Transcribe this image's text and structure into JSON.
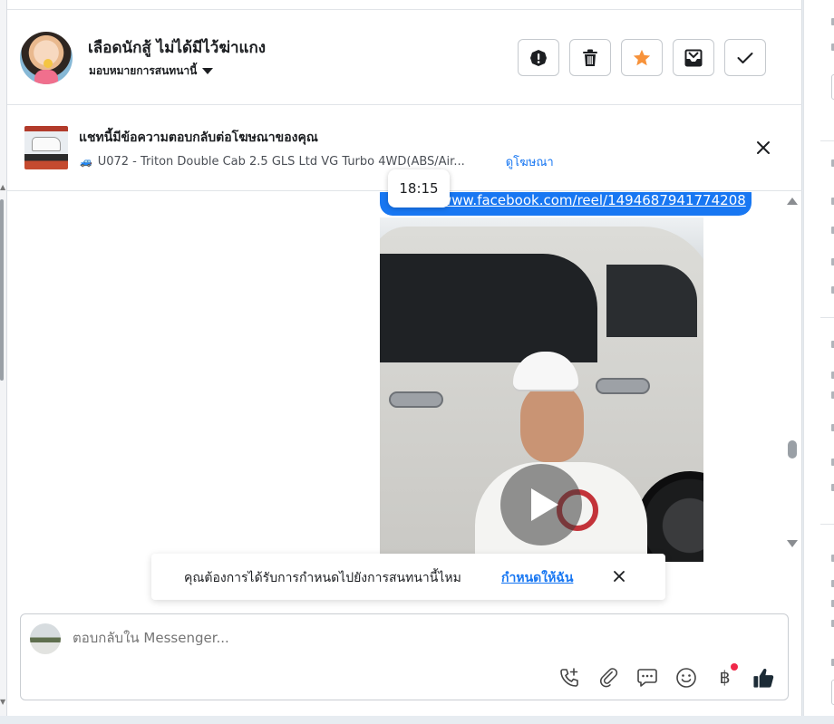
{
  "header": {
    "contact_name": "เลือดนักสู้ ไม่ได้มีไว้ฆ่าแกง",
    "assign_label": "มอบหมายการสนทนานี้",
    "actions": {
      "spam": "exclamation-icon",
      "delete": "trash-icon",
      "star": "star-icon",
      "move": "inbox-icon",
      "done": "check-icon"
    },
    "star_color": "#f7923a"
  },
  "ad_banner": {
    "title": "แชทนี้มีข้อความตอบกลับต่อโฆษณาของคุณ",
    "subtitle": "U072 - Triton Double Cab 2.5 GLS Ltd VG Turbo 4WD(ABS/Air...",
    "view_ad_link": "ดูโฆษณา"
  },
  "conversation": {
    "link_text": "www.facebook.com/reel/1494687941774208",
    "timestamp_tooltip": "18:15",
    "accent_color": "#1877f2"
  },
  "assign_prompt": {
    "question": "คุณต้องการได้รับการกำหนดไปยังการสนทนานี้ไหม",
    "action_link": "กำหนดให้ฉัน"
  },
  "composer": {
    "placeholder": "ตอบกลับใน Messenger...",
    "currency_symbol": "฿"
  }
}
